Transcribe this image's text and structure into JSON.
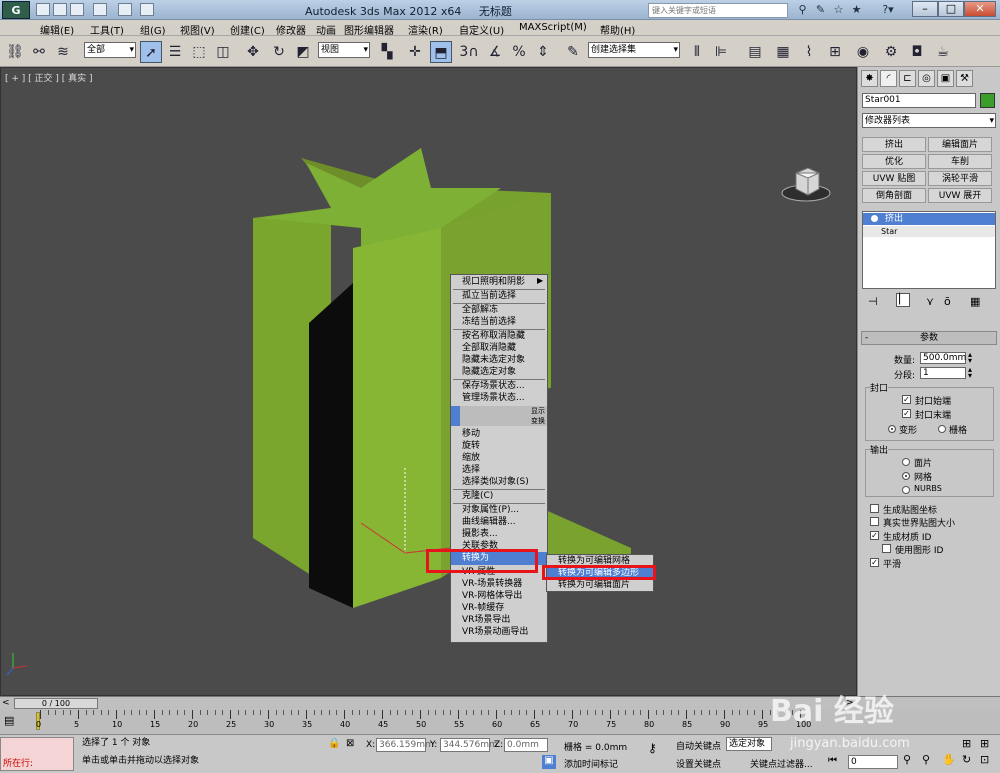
{
  "title_bar": {
    "app_title": "Autodesk 3ds Max  2012 x64",
    "file_title": "无标题",
    "search_placeholder": "键入关键字或短语",
    "help_label": "?"
  },
  "menu": [
    "编辑(E)",
    "工具(T)",
    "组(G)",
    "视图(V)",
    "创建(C)",
    "修改器",
    "动画",
    "图形编辑器",
    "渲染(R)",
    "自定义(U)",
    "MAXScript(M)",
    "帮助(H)"
  ],
  "toolbar": {
    "filter_select": "全部",
    "coord_select": "视图",
    "named_selection": "创建选择集",
    "snap_label": "3",
    "percent_label": "%"
  },
  "viewport": {
    "label": "[ + ] [ 正交 ] [ 真实 ]"
  },
  "context_menu": {
    "items": [
      "视口照明和阴影",
      "孤立当前选择",
      "全部解冻",
      "冻结当前选择",
      "按名称取消隐藏",
      "全部取消隐藏",
      "隐藏未选定对象",
      "隐藏选定对象",
      "保存场景状态...",
      "管理场景状态...",
      "",
      "",
      "移动",
      "旋转",
      "缩放",
      "选择",
      "选择类似对象(S)",
      "克隆(C)",
      "对象属性(P)...",
      "曲线编辑器...",
      "摄影表...",
      "关联参数",
      "转换为",
      "VR-属性",
      "VR-场景转换器",
      "VR-网格体导出",
      "VR-帧缓存",
      "VR场景导出",
      "VR场景动画导出"
    ],
    "quad_tags": [
      "显示",
      "变换"
    ],
    "submenu": [
      "转换为可编辑网格",
      "转换为可编辑多边形",
      "转换为可编辑面片"
    ]
  },
  "command_panel": {
    "object_name": "Star001",
    "object_color": "#3b9e2a",
    "modifier_list": "修改器列表",
    "modifier_buttons": [
      "挤出",
      "编辑面片",
      "优化",
      "车削",
      "UVW 贴图",
      "涡轮平滑",
      "倒角剖面",
      "UVW 展开"
    ],
    "stack": [
      "挤出",
      "Star"
    ],
    "params_title": "参数",
    "amount_label": "数量:",
    "amount_value": "500.0mm",
    "segments_label": "分段:",
    "segments_value": "1",
    "capping_label": "封口",
    "cap_start": "封口始端",
    "cap_end": "封口末端",
    "morph": "变形",
    "grid": "栅格",
    "output_label": "输出",
    "out_patch": "面片",
    "out_mesh": "网格",
    "out_nurbs": "NURBS",
    "gen_map": "生成贴图坐标",
    "real_world": "真实世界贴图大小",
    "gen_matid": "生成材质 ID",
    "use_shape_id": "使用图形 ID",
    "smooth": "平滑"
  },
  "timeline": {
    "frame_label": "0 / 100",
    "ticks": [
      "0",
      "5",
      "10",
      "15",
      "20",
      "25",
      "30",
      "35",
      "40",
      "45",
      "50",
      "55",
      "60",
      "65",
      "70",
      "75",
      "80",
      "85",
      "90",
      "95",
      "100"
    ]
  },
  "status": {
    "maxscript_label": "所在行:",
    "selection": "选择了 1 个 对象",
    "prompt": "单击或单击并拖动以选择对象",
    "x_label": "X:",
    "x": "366.159mm",
    "y_label": "Y:",
    "y": "344.576mm",
    "z_label": "Z:",
    "z": "0.0mm",
    "grid": "栅格 = 0.0mm",
    "auto_key": "自动关键点",
    "set_key": "设置关键点",
    "selected": "选定对象",
    "key_filters": "关键点过滤器...",
    "add_time_tag": "添加时间标记",
    "frame": "0"
  },
  "watermark": "Bai 经验",
  "watermark_url": "jingyan.baidu.com",
  "highlight_color": "#e8141c",
  "accent_color": "#4f7fd0"
}
